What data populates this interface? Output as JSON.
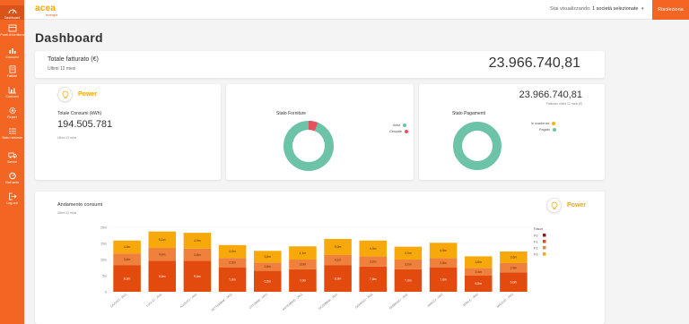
{
  "sidebar": {
    "items": [
      {
        "label": "Dashboard",
        "icon": "gauge-icon"
      },
      {
        "label": "Punti di fornitura",
        "icon": "bolt-list-icon"
      },
      {
        "label": "Consumi",
        "icon": "bar-chart-icon"
      },
      {
        "label": "Fatture",
        "icon": "invoice-icon"
      },
      {
        "label": "Consumi",
        "icon": "chart-icon"
      },
      {
        "label": "Report",
        "icon": "gear-icon"
      },
      {
        "label": "Stato richieste",
        "icon": "list-icon"
      },
      {
        "label": "Servizi",
        "icon": "truck-icon"
      },
      {
        "label": "Visti sede",
        "icon": "settings-icon"
      },
      {
        "label": "Log-out",
        "icon": "logout-icon"
      }
    ]
  },
  "header": {
    "logo_text": "acea",
    "logo_sub": "energia",
    "viewing_label": "Stai visualizzando:",
    "viewing_value": "1 società selezionate",
    "reset_label": "Risoleziona"
  },
  "page_title": "Dashboard",
  "totale": {
    "label": "Totale fatturato (€)",
    "sub": "Ultimi 12 mesi",
    "value": "23.966.740,81"
  },
  "power_card": {
    "badge": "Power",
    "label": "Totale Consumi (kWh)",
    "value": "194.505.781",
    "sub": "Ultimi 12 mesi"
  },
  "forniture_card": {
    "title": "Stato Forniture",
    "legend": [
      {
        "name": "Attivi",
        "color": "#6cc3a8",
        "share": 0.94
      },
      {
        "name": "Cessate",
        "color": "#e8505b",
        "share": 0.06
      }
    ]
  },
  "pagamenti_card": {
    "value": "23.966.740,81",
    "value_sub": "Fatturato ultimi 12 mesi (€)",
    "title": "Stato Pagamenti",
    "legend": [
      {
        "name": "In scadenza",
        "color": "#f7b500",
        "share": 0.0
      },
      {
        "name": "Pagato",
        "color": "#6cc3a8",
        "share": 1.0
      }
    ]
  },
  "consumi_chart": {
    "title": "Andamento consumi",
    "sub": "Ultimi 12 mesi",
    "badge": "Power"
  },
  "chart_data": {
    "type": "bar",
    "stacked": true,
    "categories": [
      "GIUGNO - 2021",
      "LUGLIO - 2021",
      "AGOSTO - 2021",
      "SETTEMBRE - 2021",
      "OTTOBRE - 2021",
      "NOVEMBRE - 2021",
      "DICEMBRE - 2021",
      "GENNAIO - 2022",
      "FEBBRAIO - 2022",
      "MARZO - 2022",
      "APRILE - 2022",
      "MAGGIO - 2022"
    ],
    "series": [
      {
        "name": "F1",
        "color": "#e34a0e",
        "values": [
          8.3,
          9.6,
          9.6,
          7.6,
          6.5,
          7.0,
          8.3,
          7.8,
          7.0,
          7.6,
          5.0,
          6.0
        ],
        "labels": [
          "8,3m",
          "9,6m",
          "9,6m",
          "7,6m",
          "6,5m",
          "7,0m",
          "8,3m",
          "7,8m",
          "7,0m",
          "7,6m",
          "5,0m",
          "6,0m"
        ]
      },
      {
        "name": "F2",
        "color": "#f0813c",
        "values": [
          3.6,
          4.0,
          3.8,
          2.9,
          2.6,
          3.0,
          3.1,
          3.2,
          3.0,
          2.8,
          2.4,
          2.9
        ],
        "labels": [
          "3,6m",
          "4,0m",
          "3,8m",
          "2,9m",
          "2,6m",
          "3,0m",
          "3,1m",
          "3,2m",
          "3,0m",
          "2,8m",
          "2,4m",
          "2,9m"
        ]
      },
      {
        "name": "F3",
        "color": "#f7a80a",
        "values": [
          4.0,
          5.1,
          4.9,
          4.0,
          3.6,
          4.1,
          5.0,
          4.9,
          4.0,
          4.8,
          3.6,
          3.6
        ],
        "labels": [
          "4,0m",
          "5,1m",
          "4,9m",
          "4,0m",
          "3,6m",
          "4,1m",
          "5,0m",
          "4,9m",
          "4,0m",
          "4,8m",
          "3,6m",
          "3,6m"
        ]
      }
    ],
    "y_ticks": [
      "0",
      "5m",
      "10m",
      "15m",
      "20m"
    ],
    "ylim": [
      0,
      20
    ],
    "legend_title": "Fasce",
    "legend": [
      {
        "name": "F0",
        "color": "#8b1a1a"
      },
      {
        "name": "F1",
        "color": "#e34a0e"
      },
      {
        "name": "F2",
        "color": "#f0813c"
      },
      {
        "name": "F3",
        "color": "#f7a80a"
      }
    ]
  }
}
